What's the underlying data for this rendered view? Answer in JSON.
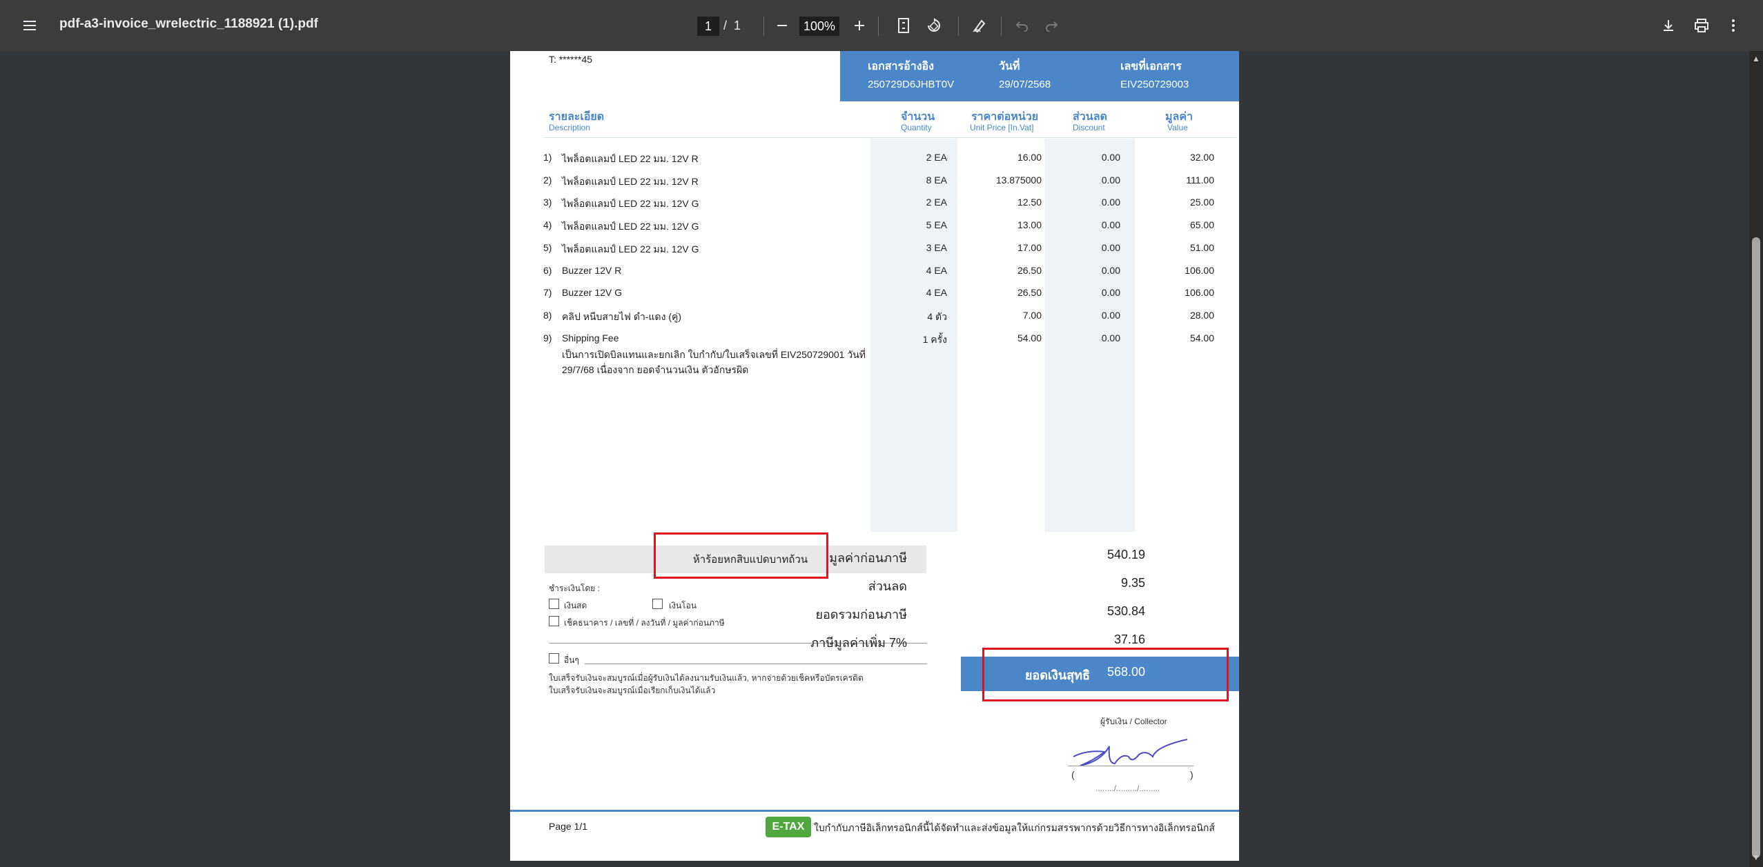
{
  "toolbar": {
    "file_name": "pdf-a3-invoice_wrelectric_1188921 (1).pdf",
    "current_page": "1",
    "page_separator": "/",
    "total_pages": "1",
    "zoom": "100%"
  },
  "invoice": {
    "phone": "T: ******45",
    "reference": {
      "ref_doc_label": "เอกสารอ้างอิง",
      "ref_doc_value": "250729D6JHBT0V",
      "date_label": "วันที่",
      "date_value": "29/07/2568",
      "doc_no_label": "เลขที่เอกสาร",
      "doc_no_value": "EIV250729003"
    },
    "headers": {
      "desc_th": "รายละเอียด",
      "desc_en": "Description",
      "qty_th": "จำนวน",
      "qty_en": "Quantity",
      "price_th": "ราคาต่อหน่วย",
      "price_en": "Unit Price [In.Vat]",
      "disc_th": "ส่วนลด",
      "disc_en": "Discount",
      "value_th": "มูลค่า",
      "value_en": "Value"
    },
    "items": [
      {
        "no": "1)",
        "desc": "ไพล็อตแลมป์ LED 22 มม. 12V R",
        "qty": "2 EA",
        "price": "16.00",
        "disc": "0.00",
        "value": "32.00"
      },
      {
        "no": "2)",
        "desc": "ไพล็อตแลมป์ LED 22 มม. 12V R",
        "qty": "8 EA",
        "price": "13.875000",
        "disc": "0.00",
        "value": "111.00"
      },
      {
        "no": "3)",
        "desc": "ไพล็อตแลมป์ LED 22 มม. 12V G",
        "qty": "2 EA",
        "price": "12.50",
        "disc": "0.00",
        "value": "25.00"
      },
      {
        "no": "4)",
        "desc": "ไพล็อตแลมป์ LED 22 มม. 12V G",
        "qty": "5 EA",
        "price": "13.00",
        "disc": "0.00",
        "value": "65.00"
      },
      {
        "no": "5)",
        "desc": "ไพล็อตแลมป์ LED 22 มม. 12V G",
        "qty": "3 EA",
        "price": "17.00",
        "disc": "0.00",
        "value": "51.00"
      },
      {
        "no": "6)",
        "desc": "Buzzer 12V R",
        "qty": "4 EA",
        "price": "26.50",
        "disc": "0.00",
        "value": "106.00"
      },
      {
        "no": "7)",
        "desc": "Buzzer 12V G",
        "qty": "4 EA",
        "price": "26.50",
        "disc": "0.00",
        "value": "106.00"
      },
      {
        "no": "8)",
        "desc": "คลิป หนีบสายไฟ ดำ-แดง (คู่)",
        "qty": "4 ตัว",
        "price": "7.00",
        "disc": "0.00",
        "value": "28.00"
      },
      {
        "no": "9)",
        "desc": "Shipping Fee",
        "qty": "1 ครั้ง",
        "price": "54.00",
        "disc": "0.00",
        "value": "54.00"
      }
    ],
    "note_line1": "เป็นการเปิดบิลแทนและยกเลิก ใบกำกับ/ใบเสร็จเลขที่ EIV250729001 วันที่",
    "note_line2": "29/7/68 เนื่องจาก ยอดจำนวนเงิน ตัวอักษรผิด",
    "amount_in_words": "ห้าร้อยหกสิบแปดบาทถ้วน",
    "payment": {
      "label": "ชำระเงินโดย :",
      "cash": "เงินสด",
      "transfer": "เงินโอน",
      "cheque": "เช็คธนาคาร / เลขที่ / ลงวันที่ / มูลค่าก่อนภาษี",
      "other": "อื่นๆ",
      "note1": "ใบเสร็จรับเงินจะสมบูรณ์เมื่อผู้รับเงินได้ลงนามรับเงินแล้ว, หากจ่ายด้วยเช็คหรือบัตรเครดิต",
      "note2": "ใบเสร็จรับเงินจะสมบูรณ์เมื่อเรียกเก็บเงินได้แล้ว"
    },
    "totals": {
      "pre_tax_label": "มูลค่าก่อนภาษี",
      "pre_tax_value": "540.19",
      "discount_label": "ส่วนลด",
      "discount_value": "9.35",
      "subtotal_label": "ยอดรวมก่อนภาษี",
      "subtotal_value": "530.84",
      "vat_label": "ภาษีมูลค่าเพิ่ม 7%",
      "vat_value": "37.16",
      "net_label": "ยอดเงินสุทธิ",
      "net_value": "568.00"
    },
    "collector_label": "ผู้รับเงิน / Collector",
    "sign_open": "(",
    "sign_close": ")",
    "date_blank": "......../........./.........",
    "page_label": "Page 1/1",
    "etax_logo": "E-TAX",
    "etax_text": "ใบกำกับภาษีอิเล็กทรอนิกส์นี้ได้จัดทำและส่งข้อมูลให้แก่กรมสรรพากรด้วยวิธีการทางอิเล็กทรอนิกส์"
  },
  "colors": {
    "accent": "#4a86c8",
    "highlight": "#e0141e"
  }
}
